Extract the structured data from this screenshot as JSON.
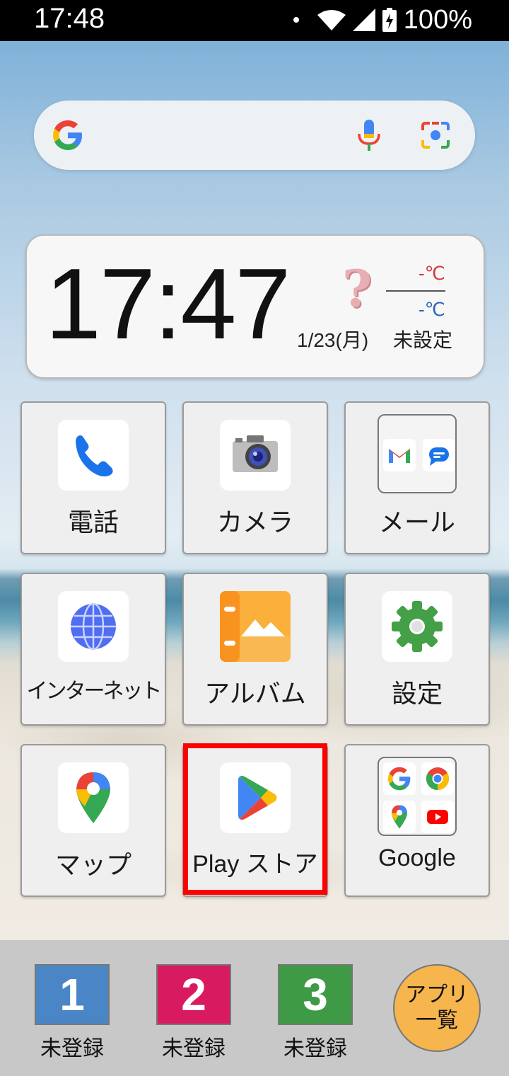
{
  "status_bar": {
    "time": "17:48",
    "battery": "100%",
    "icons": [
      "notification-dot-icon",
      "wifi-icon",
      "cell-signal-icon",
      "battery-charging-icon"
    ]
  },
  "search_bar": {
    "icons": [
      "google-g-icon",
      "mic-icon",
      "google-lens-icon"
    ]
  },
  "clock_widget": {
    "time": "17:47",
    "date": "1/23(月)",
    "weather_icon": "?",
    "temp_high": "-℃",
    "temp_low": "-℃",
    "location": "未設定",
    "colors": {
      "high": "#d0393b",
      "low": "#2a63b8"
    }
  },
  "apps": [
    {
      "label": "電話",
      "icon": "phone-icon"
    },
    {
      "label": "カメラ",
      "icon": "camera-icon"
    },
    {
      "label": "メール",
      "icon": "mail-folder-icon",
      "folder": [
        "gmail-icon",
        "messages-icon"
      ]
    },
    {
      "label": "インターネット",
      "icon": "globe-icon"
    },
    {
      "label": "アルバム",
      "icon": "album-icon"
    },
    {
      "label": "設定",
      "icon": "settings-gear-icon"
    },
    {
      "label": "マップ",
      "icon": "maps-pin-icon"
    },
    {
      "label": "Play ストア",
      "icon": "play-store-icon",
      "highlighted": true
    },
    {
      "label": "Google",
      "icon": "google-folder-icon",
      "folder": [
        "google-g-icon",
        "chrome-icon",
        "maps-pin-icon",
        "youtube-icon"
      ]
    }
  ],
  "dock": {
    "speed_dials": [
      {
        "number": "1",
        "label": "未登録",
        "color": "#4a86c5"
      },
      {
        "number": "2",
        "label": "未登録",
        "color": "#d81b60"
      },
      {
        "number": "3",
        "label": "未登録",
        "color": "#3e9a44"
      }
    ],
    "all_apps": "アプリ一覧",
    "all_apps_color": "#f7b54e"
  },
  "highlight_color": "#ff0000"
}
